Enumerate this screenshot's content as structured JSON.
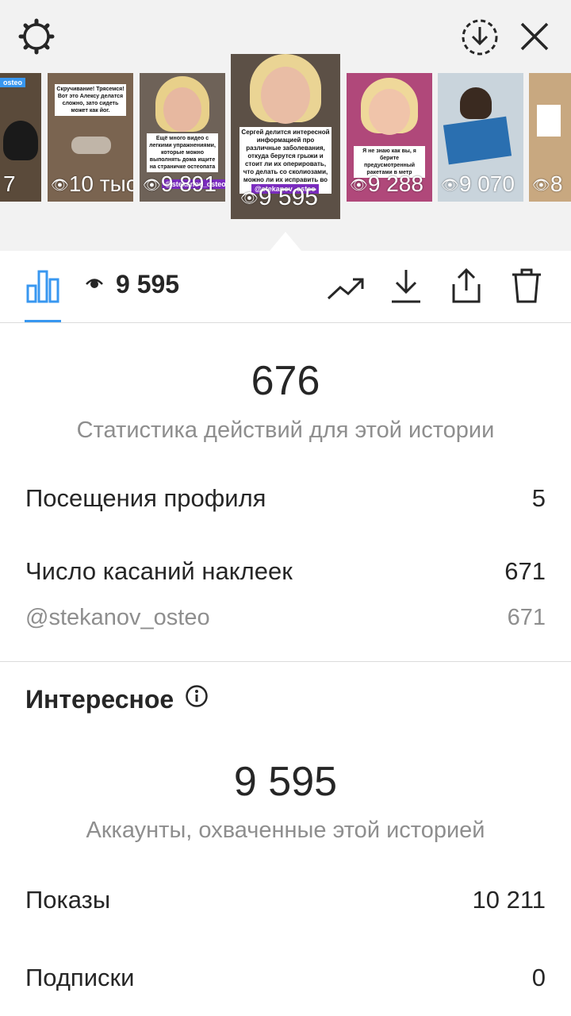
{
  "header": {
    "settings_icon": "gear-icon",
    "download_icon": "download-circle-icon",
    "close_icon": "close-icon"
  },
  "stories": [
    {
      "views": "7",
      "caption": "",
      "tag": "osteo"
    },
    {
      "views": "10 тыс",
      "caption": "Скручивание! Трясемся! Вот это Алексу делатся сложно, зато сидеть может как йог.",
      "tag": ""
    },
    {
      "views": "9 891",
      "caption": "Ещё много видео с легкими упражнениями, которые можно выполнять дома ищите на страничке остеопата",
      "tag": "@stekanov_osteo"
    },
    {
      "views": "9 595",
      "caption": "Сергей делится интересной информацией про различные заболевания, откуда берутся грыжи и стоит ли их оперировать, что делать со сколиозами, можно ли их исправить во взрослой жизни.",
      "tag": "@stekanov_osteo"
    },
    {
      "views": "9 288",
      "caption": "Я не знаю как вы, я берите предусмотренный ракетами в метр",
      "tag": ""
    },
    {
      "views": "9 070",
      "caption": "",
      "tag": ""
    },
    {
      "views": "8",
      "caption": "",
      "tag": ""
    }
  ],
  "toolbar": {
    "views": "9 595",
    "stats_icon": "bar-chart-icon",
    "eye_icon": "eye-icon",
    "promote_icon": "trend-up-icon",
    "save_icon": "download-icon",
    "share_icon": "share-icon",
    "delete_icon": "trash-icon"
  },
  "actions": {
    "total": "676",
    "label": "Статистика действий для этой истории",
    "rows": [
      {
        "label": "Посещения профиля",
        "value": "5"
      },
      {
        "label": "Число касаний наклеек",
        "value": "671"
      }
    ],
    "sub_row": {
      "label": "@stekanov_osteo",
      "value": "671"
    }
  },
  "discovery": {
    "title": "Интересное",
    "info_icon": "info-icon",
    "reach": "9 595",
    "reach_label": "Аккаунты, охваченные этой историей",
    "rows": [
      {
        "label": "Показы",
        "value": "10 211"
      },
      {
        "label": "Подписки",
        "value": "0"
      }
    ]
  },
  "colors": {
    "accent": "#3897f0",
    "muted": "#8e8e8e",
    "text": "#262626",
    "tag_purple": "#7b2cbf"
  }
}
